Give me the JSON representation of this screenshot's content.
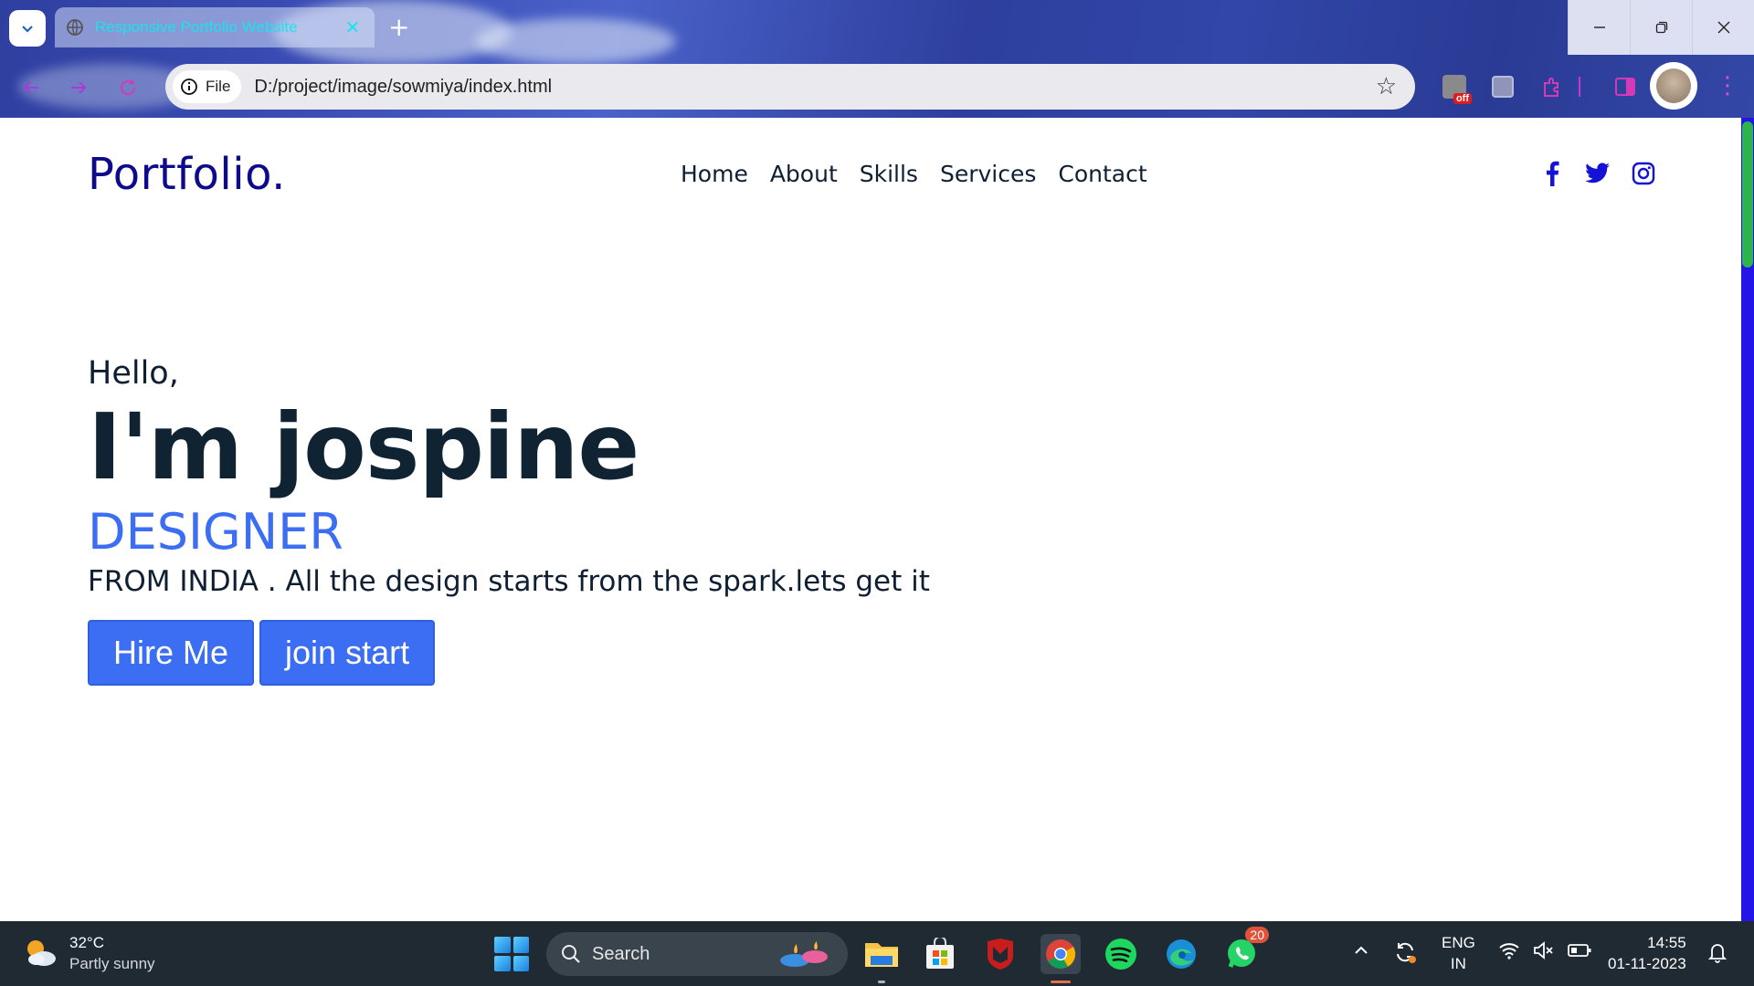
{
  "browser": {
    "tab_title": "Responsive Portfolio Website",
    "tab_close": "✕",
    "new_tab": "+",
    "file_chip_label": "File",
    "url": "D:/project/image/sowmiya/index.html",
    "ext_badge": "off"
  },
  "site": {
    "logo": "Portfolio.",
    "nav": [
      "Home",
      "About",
      "Skills",
      "Services",
      "Contact"
    ],
    "social_icons": [
      "facebook-icon",
      "twitter-icon",
      "instagram-icon"
    ],
    "accent_color": "#3b6ef2",
    "logo_color": "#0d0b8c"
  },
  "hero": {
    "greeting": "Hello,",
    "name": "I'm jospine",
    "role": "DESIGNER",
    "tagline": "FROM INDIA . All the design starts from the spark.lets get it",
    "buttons": [
      "Hire Me",
      "join start"
    ]
  },
  "taskbar": {
    "temperature": "32°C",
    "weather": "Partly sunny",
    "search_label": "Search",
    "whatsapp_badge": "20",
    "lang_top": "ENG",
    "lang_bottom": "IN",
    "time": "14:55",
    "date": "01-11-2023"
  }
}
